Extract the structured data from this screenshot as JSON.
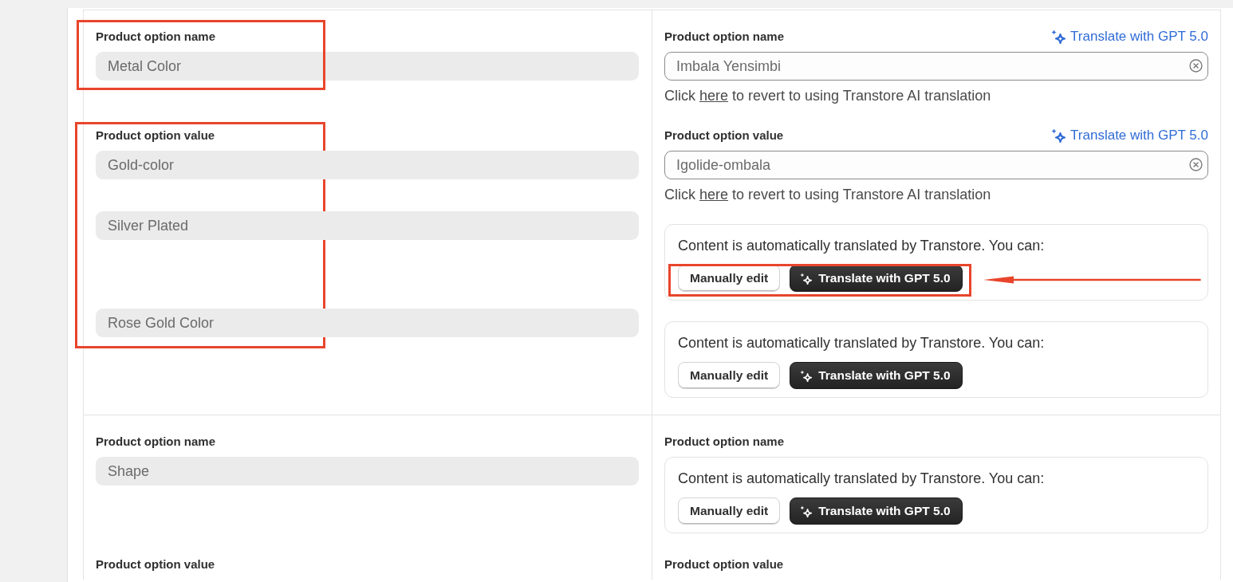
{
  "rows": [
    {
      "source": {
        "name": {
          "label": "Product option name",
          "value": "Metal Color",
          "highlight_box": true
        },
        "values": {
          "label": "Product option value",
          "items": [
            "Gold-color",
            "Silver Plated",
            "Rose Gold Color"
          ],
          "highlight_box": true
        }
      },
      "target": {
        "name": {
          "label": "Product option name",
          "link": "Translate with GPT 5.0",
          "entries": [
            {
              "kind": "edited",
              "value": "Imbala Yensimbi",
              "hint": {
                "before": "Click",
                "link": "here",
                "after": "to revert to using Transtore AI translation"
              }
            }
          ]
        },
        "values": {
          "label": "Product option value",
          "link": "Translate with GPT 5.0",
          "entries": [
            {
              "kind": "edited",
              "value": "Igolide-ombala",
              "hint": {
                "before": "Click",
                "link": "here",
                "after": "to revert to using Transtore AI translation"
              }
            },
            {
              "kind": "auto",
              "message": "Content is automatically translated by Transtore. You can:",
              "buttons": [
                {
                  "kind": "secondary",
                  "label": "Manually edit"
                },
                {
                  "kind": "primary",
                  "label": "Translate with GPT 5.0"
                }
              ],
              "highlight_box": true,
              "pointer_arrow": true
            },
            {
              "kind": "auto",
              "message": "Content is automatically translated by Transtore. You can:",
              "buttons": [
                {
                  "kind": "secondary",
                  "label": "Manually edit"
                },
                {
                  "kind": "primary",
                  "label": "Translate with GPT 5.0"
                }
              ],
              "highlight_box": false,
              "pointer_arrow": false
            }
          ]
        }
      }
    },
    {
      "source": {
        "name": {
          "label": "Product option name",
          "value": "Shape",
          "highlight_box": false
        },
        "values": {
          "label": "Product option value",
          "highlight_box": false
        }
      },
      "target": {
        "name": {
          "label": "Product option name",
          "entries": [
            {
              "kind": "auto",
              "message": "Content is automatically translated by Transtore. You can:",
              "buttons": [
                {
                  "kind": "secondary",
                  "label": "Manually edit"
                },
                {
                  "kind": "primary",
                  "label": "Translate with GPT 5.0"
                }
              ],
              "highlight_box": false,
              "pointer_arrow": false
            }
          ]
        },
        "values": {
          "label": "Product option value"
        }
      }
    }
  ]
}
